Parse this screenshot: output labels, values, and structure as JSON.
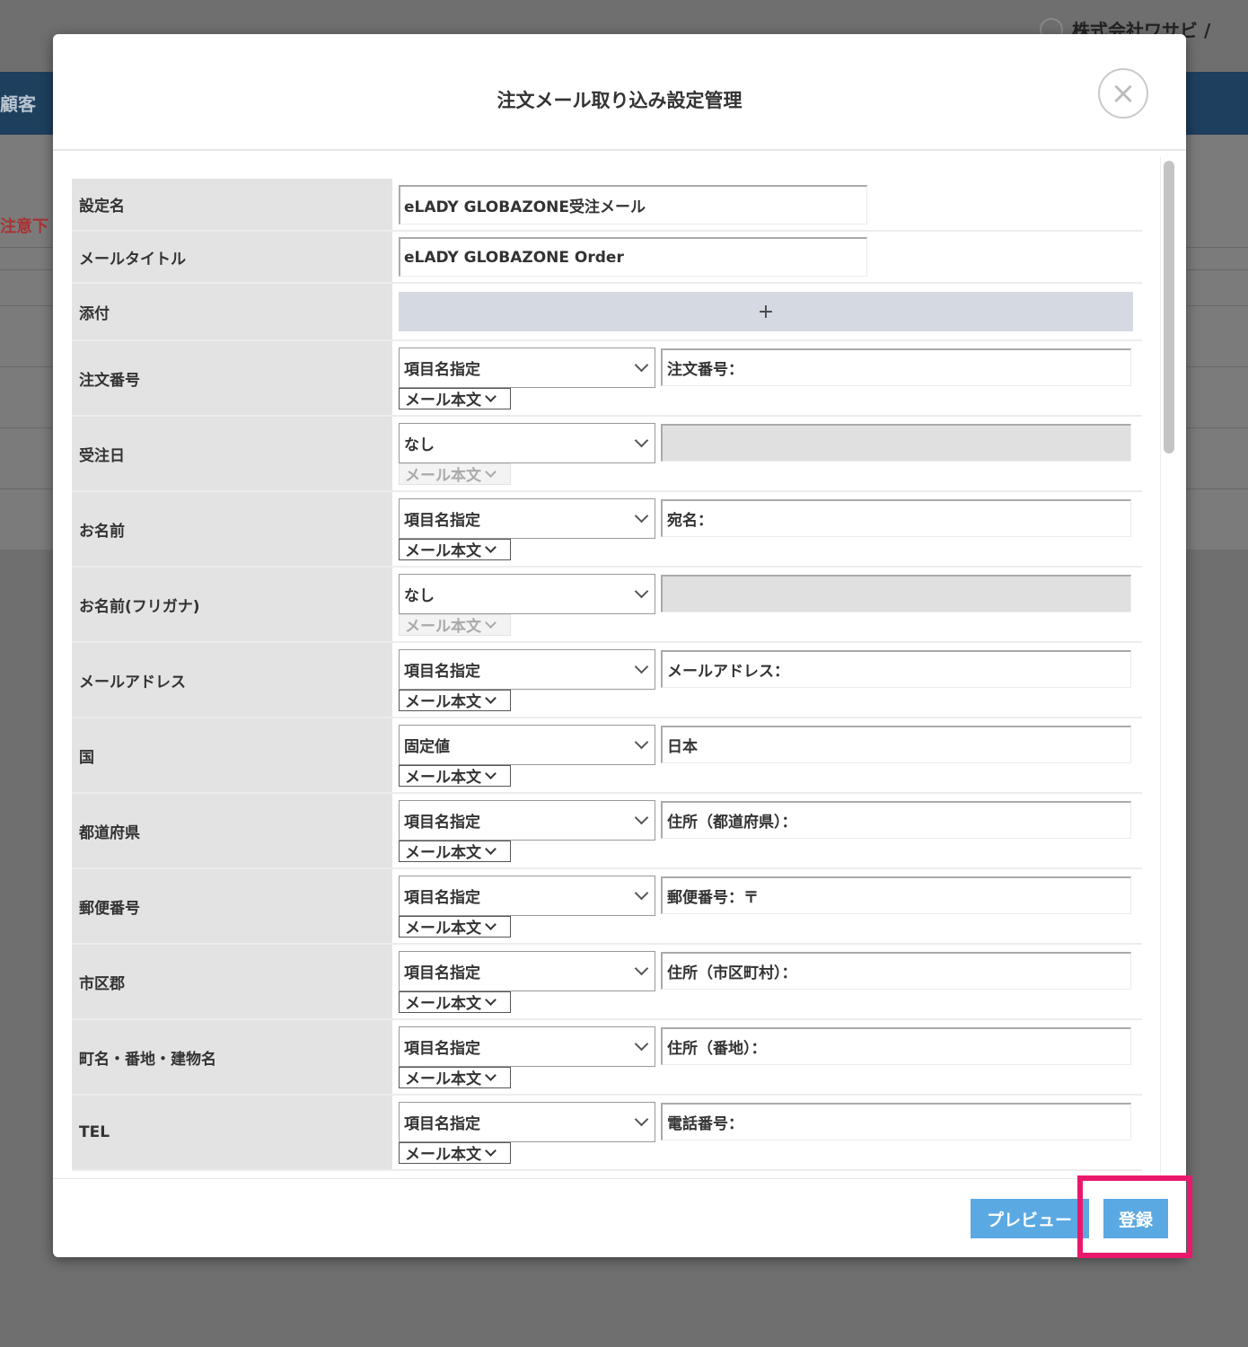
{
  "background": {
    "user_name": "株式会社ワサビ /",
    "nav_text": "顧客",
    "warning_text": "注意下"
  },
  "modal": {
    "title": "注文メール取り込み設定管理",
    "close_glyph": "×",
    "setting_name": {
      "label": "設定名",
      "value": "eLADY GLOBAZONE受注メール"
    },
    "mail_title": {
      "label": "メールタイトル",
      "value": "eLADY GLOBAZONE Order"
    },
    "attachment": {
      "label": "添付",
      "add_glyph": "+"
    },
    "fields": [
      {
        "label": "注文番号",
        "mode": "項目名指定",
        "source": "メール本文",
        "value": "注文番号：",
        "disabled": false
      },
      {
        "label": "受注日",
        "mode": "なし",
        "source": "メール本文",
        "value": "",
        "disabled": true
      },
      {
        "label": "お名前",
        "mode": "項目名指定",
        "source": "メール本文",
        "value": "宛名：",
        "disabled": false
      },
      {
        "label": "お名前(フリガナ)",
        "mode": "なし",
        "source": "メール本文",
        "value": "",
        "disabled": true
      },
      {
        "label": "メールアドレス",
        "mode": "項目名指定",
        "source": "メール本文",
        "value": "メールアドレス：",
        "disabled": false
      },
      {
        "label": "国",
        "mode": "固定値",
        "source": "メール本文",
        "value": "日本",
        "disabled": false
      },
      {
        "label": "都道府県",
        "mode": "項目名指定",
        "source": "メール本文",
        "value": "住所（都道府県）：",
        "disabled": false
      },
      {
        "label": "郵便番号",
        "mode": "項目名指定",
        "source": "メール本文",
        "value": "郵便番号：〒",
        "disabled": false
      },
      {
        "label": "市区郡",
        "mode": "項目名指定",
        "source": "メール本文",
        "value": "住所（市区町村）：",
        "disabled": false
      },
      {
        "label": "町名・番地・建物名",
        "mode": "項目名指定",
        "source": "メール本文",
        "value": "住所（番地）：",
        "disabled": false
      },
      {
        "label": "TEL",
        "mode": "項目名指定",
        "source": "メール本文",
        "value": "電話番号：",
        "disabled": false
      }
    ],
    "footer": {
      "preview_label": "プレビュー",
      "register_label": "登録"
    }
  },
  "colors": {
    "primary_button": "#5ba9e2",
    "highlight": "#e9186c",
    "navbar": "#1e3f5e"
  }
}
